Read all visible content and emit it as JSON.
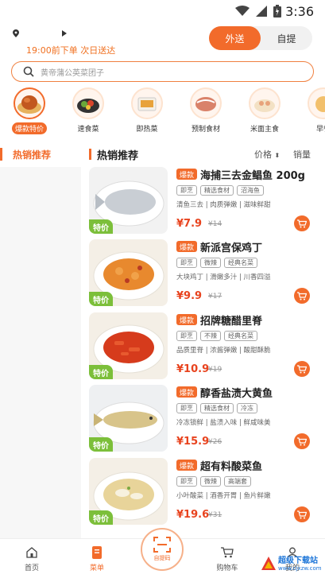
{
  "status_bar": {
    "time": "3:36"
  },
  "header": {
    "delivery_note": "19:00前下单 次日送达",
    "modes": [
      "外送",
      "自提"
    ],
    "search_placeholder": "黄帝蒲公英菜团子"
  },
  "categories": [
    {
      "label": "爆款特价",
      "selected": true
    },
    {
      "label": "速食菜",
      "selected": false
    },
    {
      "label": "即热菜",
      "selected": false
    },
    {
      "label": "预制食材",
      "selected": false
    },
    {
      "label": "米面主食",
      "selected": false
    },
    {
      "label": "早餐",
      "selected": false
    }
  ],
  "sidebar": {
    "items": [
      "热销推荐"
    ]
  },
  "list": {
    "title": "热销推荐",
    "sort_price": "价格",
    "sort_sales": "销量",
    "special_badge": "特价",
    "hot_badge": "爆款",
    "products": [
      {
        "name": "海捕三去金鲳鱼 200g",
        "tags": [
          "即烹",
          "精选食材",
          "沼海鱼"
        ],
        "desc": "清鱼三去 | 肉质弹嫩 | 滋味鲜甜",
        "price": "¥7.9",
        "orig": "¥14"
      },
      {
        "name": "新派宫保鸡丁",
        "tags": [
          "即烹",
          "微辣",
          "经典名菜"
        ],
        "desc": "大块鸡丁 | 滑嫩多汁 | 川香四溢",
        "price": "¥9.9",
        "orig": "¥17"
      },
      {
        "name": "招牌糖醋里脊",
        "tags": [
          "即烹",
          "不辣",
          "经典名菜"
        ],
        "desc": "品质里脊 | 浓酱弹嫩 | 酸甜酥脆",
        "price": "¥10.9",
        "orig": "¥19"
      },
      {
        "name": "醇香盐渍大黄鱼",
        "tags": [
          "即烹",
          "精选食材",
          "冷冻"
        ],
        "desc": "冷冻锁鲜 | 盐渍入味 | 鲜咸味美",
        "price": "¥15.9",
        "orig": "¥26"
      },
      {
        "name": "超有料酸菜鱼",
        "tags": [
          "即烹",
          "微辣",
          "高端套"
        ],
        "desc": "小叶酸菜 | 酒香开胃 | 鱼片鲜嫩",
        "price": "¥19.6",
        "orig": "¥31"
      }
    ]
  },
  "bottom_nav": {
    "items": [
      "首页",
      "菜单",
      "购物车",
      "我的"
    ],
    "scan_label": "自提码",
    "active": "菜单"
  },
  "watermark": {
    "text": "超级下载站",
    "url": "www.cjxzw.com"
  },
  "colors": {
    "accent": "#f26b2b",
    "price": "#e8431e",
    "special": "#7cbf3a"
  }
}
